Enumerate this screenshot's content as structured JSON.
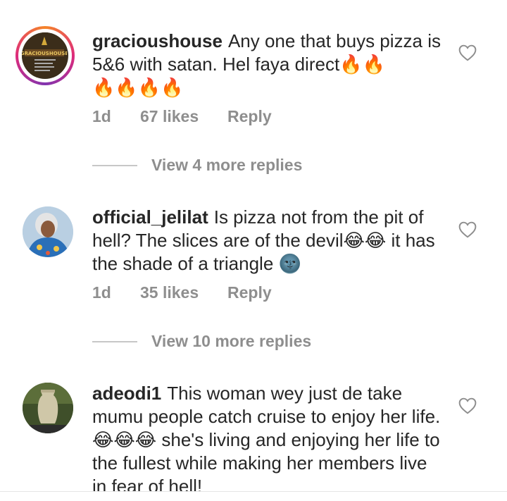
{
  "comments": [
    {
      "username": "gracioushouse",
      "text": "Any one that buys pizza is 5&6 with satan. Hel faya direct🔥🔥\n🔥🔥🔥🔥",
      "time": "1d",
      "likes": "67 likes",
      "reply": "Reply",
      "view_replies": "View 4 more replies",
      "avatar_text": "GRACIOUSHOUSE"
    },
    {
      "username": "official_jelilat",
      "text": "Is pizza not from the pit of hell? The slices are of the devil😂😂 it has the shade of a triangle 🌚",
      "time": "1d",
      "likes": "35 likes",
      "reply": "Reply",
      "view_replies": "View 10 more replies"
    },
    {
      "username": "adeodi1",
      "text": "This woman wey just de take mumu people catch cruise to enjoy her life. 😂😂😂 she's living and enjoying her life to the fullest while making her members live in fear of hell!"
    }
  ],
  "colors": {
    "text": "#262626",
    "muted": "#8e8e8e",
    "divider": "#c7c7c7"
  },
  "icons": [
    "heart-outline-icon"
  ]
}
